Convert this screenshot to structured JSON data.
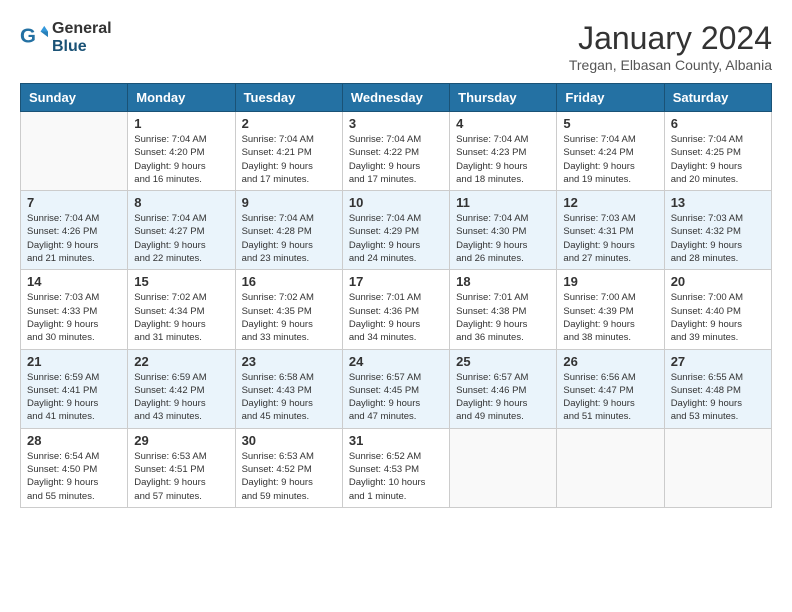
{
  "header": {
    "logo_general": "General",
    "logo_blue": "Blue",
    "month_title": "January 2024",
    "location": "Tregan, Elbasan County, Albania"
  },
  "columns": [
    "Sunday",
    "Monday",
    "Tuesday",
    "Wednesday",
    "Thursday",
    "Friday",
    "Saturday"
  ],
  "weeks": [
    [
      {
        "day": "",
        "info": ""
      },
      {
        "day": "1",
        "info": "Sunrise: 7:04 AM\nSunset: 4:20 PM\nDaylight: 9 hours\nand 16 minutes."
      },
      {
        "day": "2",
        "info": "Sunrise: 7:04 AM\nSunset: 4:21 PM\nDaylight: 9 hours\nand 17 minutes."
      },
      {
        "day": "3",
        "info": "Sunrise: 7:04 AM\nSunset: 4:22 PM\nDaylight: 9 hours\nand 17 minutes."
      },
      {
        "day": "4",
        "info": "Sunrise: 7:04 AM\nSunset: 4:23 PM\nDaylight: 9 hours\nand 18 minutes."
      },
      {
        "day": "5",
        "info": "Sunrise: 7:04 AM\nSunset: 4:24 PM\nDaylight: 9 hours\nand 19 minutes."
      },
      {
        "day": "6",
        "info": "Sunrise: 7:04 AM\nSunset: 4:25 PM\nDaylight: 9 hours\nand 20 minutes."
      }
    ],
    [
      {
        "day": "7",
        "info": "Sunrise: 7:04 AM\nSunset: 4:26 PM\nDaylight: 9 hours\nand 21 minutes."
      },
      {
        "day": "8",
        "info": "Sunrise: 7:04 AM\nSunset: 4:27 PM\nDaylight: 9 hours\nand 22 minutes."
      },
      {
        "day": "9",
        "info": "Sunrise: 7:04 AM\nSunset: 4:28 PM\nDaylight: 9 hours\nand 23 minutes."
      },
      {
        "day": "10",
        "info": "Sunrise: 7:04 AM\nSunset: 4:29 PM\nDaylight: 9 hours\nand 24 minutes."
      },
      {
        "day": "11",
        "info": "Sunrise: 7:04 AM\nSunset: 4:30 PM\nDaylight: 9 hours\nand 26 minutes."
      },
      {
        "day": "12",
        "info": "Sunrise: 7:03 AM\nSunset: 4:31 PM\nDaylight: 9 hours\nand 27 minutes."
      },
      {
        "day": "13",
        "info": "Sunrise: 7:03 AM\nSunset: 4:32 PM\nDaylight: 9 hours\nand 28 minutes."
      }
    ],
    [
      {
        "day": "14",
        "info": "Sunrise: 7:03 AM\nSunset: 4:33 PM\nDaylight: 9 hours\nand 30 minutes."
      },
      {
        "day": "15",
        "info": "Sunrise: 7:02 AM\nSunset: 4:34 PM\nDaylight: 9 hours\nand 31 minutes."
      },
      {
        "day": "16",
        "info": "Sunrise: 7:02 AM\nSunset: 4:35 PM\nDaylight: 9 hours\nand 33 minutes."
      },
      {
        "day": "17",
        "info": "Sunrise: 7:01 AM\nSunset: 4:36 PM\nDaylight: 9 hours\nand 34 minutes."
      },
      {
        "day": "18",
        "info": "Sunrise: 7:01 AM\nSunset: 4:38 PM\nDaylight: 9 hours\nand 36 minutes."
      },
      {
        "day": "19",
        "info": "Sunrise: 7:00 AM\nSunset: 4:39 PM\nDaylight: 9 hours\nand 38 minutes."
      },
      {
        "day": "20",
        "info": "Sunrise: 7:00 AM\nSunset: 4:40 PM\nDaylight: 9 hours\nand 39 minutes."
      }
    ],
    [
      {
        "day": "21",
        "info": "Sunrise: 6:59 AM\nSunset: 4:41 PM\nDaylight: 9 hours\nand 41 minutes."
      },
      {
        "day": "22",
        "info": "Sunrise: 6:59 AM\nSunset: 4:42 PM\nDaylight: 9 hours\nand 43 minutes."
      },
      {
        "day": "23",
        "info": "Sunrise: 6:58 AM\nSunset: 4:43 PM\nDaylight: 9 hours\nand 45 minutes."
      },
      {
        "day": "24",
        "info": "Sunrise: 6:57 AM\nSunset: 4:45 PM\nDaylight: 9 hours\nand 47 minutes."
      },
      {
        "day": "25",
        "info": "Sunrise: 6:57 AM\nSunset: 4:46 PM\nDaylight: 9 hours\nand 49 minutes."
      },
      {
        "day": "26",
        "info": "Sunrise: 6:56 AM\nSunset: 4:47 PM\nDaylight: 9 hours\nand 51 minutes."
      },
      {
        "day": "27",
        "info": "Sunrise: 6:55 AM\nSunset: 4:48 PM\nDaylight: 9 hours\nand 53 minutes."
      }
    ],
    [
      {
        "day": "28",
        "info": "Sunrise: 6:54 AM\nSunset: 4:50 PM\nDaylight: 9 hours\nand 55 minutes."
      },
      {
        "day": "29",
        "info": "Sunrise: 6:53 AM\nSunset: 4:51 PM\nDaylight: 9 hours\nand 57 minutes."
      },
      {
        "day": "30",
        "info": "Sunrise: 6:53 AM\nSunset: 4:52 PM\nDaylight: 9 hours\nand 59 minutes."
      },
      {
        "day": "31",
        "info": "Sunrise: 6:52 AM\nSunset: 4:53 PM\nDaylight: 10 hours\nand 1 minute."
      },
      {
        "day": "",
        "info": ""
      },
      {
        "day": "",
        "info": ""
      },
      {
        "day": "",
        "info": ""
      }
    ]
  ]
}
